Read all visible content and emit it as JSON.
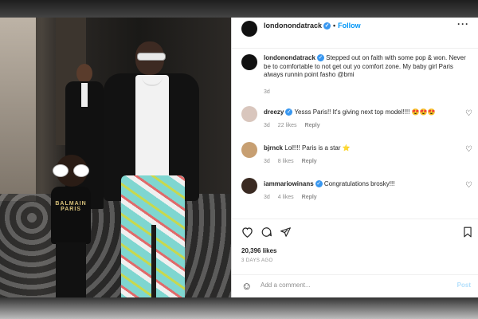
{
  "post": {
    "username": "londonondatrack",
    "follow_label": "Follow",
    "caption": "Stepped out on faith with some pop & won. Never be to comfortable to not get out yo comfort zone. My baby girl Paris always runnin point fasho @bmi",
    "caption_time": "3d",
    "photo_brand_text": "BALMAIN PARIS",
    "likes": "20,396 likes",
    "date": "3 DAYS AGO",
    "add_comment_placeholder": "Add a comment...",
    "post_label": "Post"
  },
  "comments": [
    {
      "user": "dreezy",
      "verified": true,
      "text": "Yesss Paris!! It's giving next top model!!!! 😍😍😍",
      "time": "3d",
      "likes": "22 likes",
      "reply": "Reply"
    },
    {
      "user": "bjrnck",
      "verified": false,
      "text": "Lol!!!! Paris is a star ⭐",
      "time": "3d",
      "likes": "8 likes",
      "reply": "Reply"
    },
    {
      "user": "iammariowinans",
      "verified": true,
      "text": "Congratulations brosky!!!",
      "time": "3d",
      "likes": "4 likes",
      "reply": "Reply"
    }
  ],
  "icons": [
    "more-icon",
    "heart-icon",
    "comment-icon",
    "share-icon",
    "bookmark-icon",
    "emoji-icon",
    "verified-icon"
  ],
  "colors": {
    "link_blue": "#0095f6",
    "verified_blue": "#3897f0",
    "muted_text": "#8e8e8e",
    "post_button": "#b2dffc"
  }
}
